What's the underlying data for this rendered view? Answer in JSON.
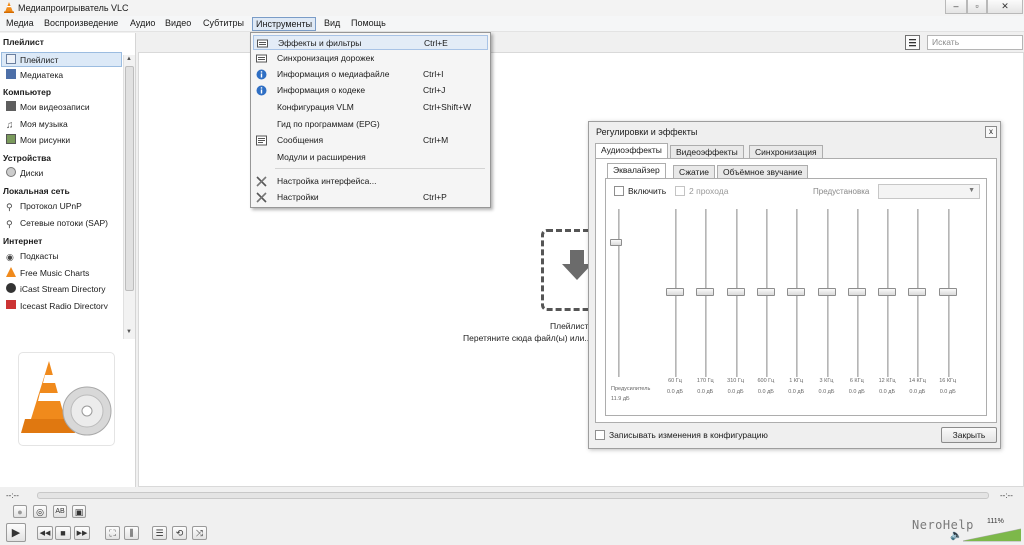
{
  "window": {
    "title": "Медиапроигрыватель VLC"
  },
  "menu": {
    "items": [
      "Медиа",
      "Воспроизведение",
      "Аудио",
      "Видео",
      "Субтитры",
      "Инструменты",
      "Вид",
      "Помощь"
    ]
  },
  "sidebar": {
    "sections": [
      {
        "header": "Плейлист",
        "items": [
          "Плейлист",
          "Медиатека"
        ]
      },
      {
        "header": "Компьютер",
        "items": [
          "Мои видеозаписи",
          "Моя музыка",
          "Мои рисунки"
        ]
      },
      {
        "header": "Устройства",
        "items": [
          "Диски"
        ]
      },
      {
        "header": "Локальная сеть",
        "items": [
          "Протокол UPnP",
          "Сетевые потоки (SAP)"
        ]
      },
      {
        "header": "Интернет",
        "items": [
          "Подкасты",
          "Free Music Charts",
          "iCast Stream Directory",
          "Icecast Radio Directory"
        ]
      }
    ],
    "selected": "Плейлист"
  },
  "search": {
    "placeholder": "Искать"
  },
  "playlist_empty": {
    "title": "Плейлист",
    "hint": "Перетяните сюда файл(ы) или..."
  },
  "tools_menu": {
    "items": [
      {
        "label": "Эффекты и фильтры",
        "shortcut": "Ctrl+E",
        "icon": "effects-icon"
      },
      {
        "label": "Синхронизация дорожек",
        "shortcut": "",
        "icon": "sync-icon"
      },
      {
        "label": "Информация о медиафайле",
        "shortcut": "Ctrl+I",
        "icon": "info-icon"
      },
      {
        "label": "Информация о кодеке",
        "shortcut": "Ctrl+J",
        "icon": "info-icon"
      },
      {
        "label": "Конфигурация VLM",
        "shortcut": "Ctrl+Shift+W",
        "icon": ""
      },
      {
        "label": "Гид по программам (EPG)",
        "shortcut": "",
        "icon": ""
      },
      {
        "label": "Сообщения",
        "shortcut": "Ctrl+M",
        "icon": "messages-icon"
      },
      {
        "label": "Модули и расширения",
        "shortcut": "",
        "icon": ""
      },
      {
        "label": "Настройка интерфейса...",
        "shortcut": "",
        "icon": "tools-icon"
      },
      {
        "label": "Настройки",
        "shortcut": "Ctrl+P",
        "icon": "tools-icon"
      }
    ]
  },
  "effects_dialog": {
    "title": "Регулировки и эффекты",
    "close_glyph": "x",
    "tabs": [
      "Аудиоэффекты",
      "Видеоэффекты",
      "Синхронизация"
    ],
    "subtabs": [
      "Эквалайзер",
      "Сжатие",
      "Объёмное звучание"
    ],
    "enable_label": "Включить",
    "two_pass_label": "2 прохода",
    "preset_label": "Предустановка",
    "preamp_label": "Предусилитель",
    "preamp_value": "11.9 дБ",
    "bands": [
      {
        "freq": "60 Гц",
        "value": "0.0 дБ"
      },
      {
        "freq": "170 Гц",
        "value": "0.0 дБ"
      },
      {
        "freq": "310 Гц",
        "value": "0.0 дБ"
      },
      {
        "freq": "600 Гц",
        "value": "0.0 дБ"
      },
      {
        "freq": "1 КГц",
        "value": "0.0 дБ"
      },
      {
        "freq": "3 КГц",
        "value": "0.0 дБ"
      },
      {
        "freq": "6 КГц",
        "value": "0.0 дБ"
      },
      {
        "freq": "12 КГц",
        "value": "0.0 дБ"
      },
      {
        "freq": "14 КГц",
        "value": "0.0 дБ"
      },
      {
        "freq": "16 КГц",
        "value": "0.0 дБ"
      }
    ],
    "save_label": "Записывать изменения в конфигурацию",
    "close_label": "Закрыть"
  },
  "player": {
    "time_left": "--:--",
    "time_right": "--:--",
    "volume_pct": "111%",
    "watermark": "NeroHelp"
  }
}
